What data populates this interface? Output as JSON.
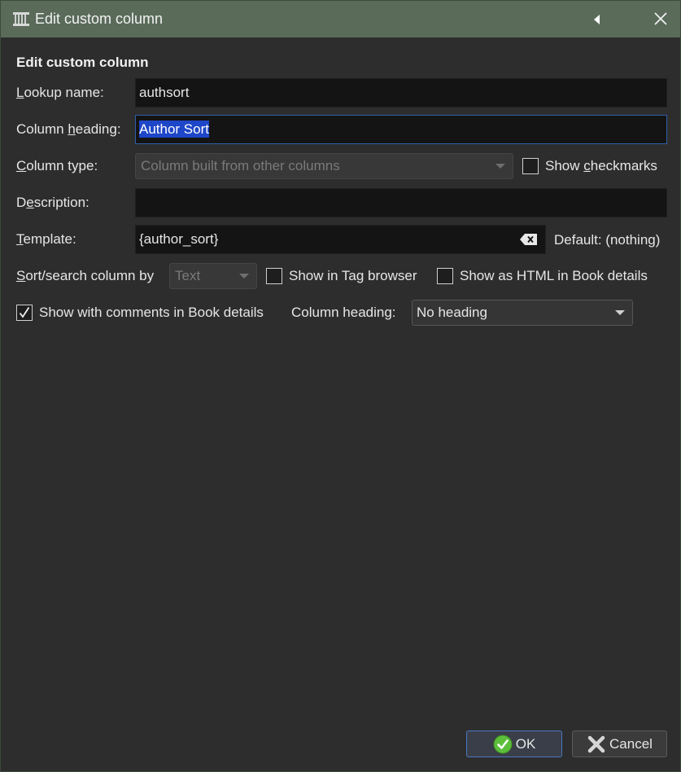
{
  "window": {
    "title": "Edit custom column",
    "colors": {
      "titlebar": "#5a6b5a",
      "background": "#2d2d2d",
      "accent": "#1e46c8"
    }
  },
  "dialog": {
    "heading": "Edit custom column"
  },
  "lookup": {
    "label_u": "L",
    "label_rest": "ookup name:",
    "value": "authsort"
  },
  "column_heading": {
    "label_pre": "Column ",
    "label_u": "h",
    "label_rest": "eading:",
    "value": "Author Sort"
  },
  "column_type": {
    "label_u": "C",
    "label_rest": "olumn type:",
    "value": "Column built from other columns",
    "show_checkmarks_pre": "Show ",
    "show_checkmarks_u": "c",
    "show_checkmarks_rest": "heckmarks",
    "show_checkmarks_checked": false
  },
  "description": {
    "label_pre": "D",
    "label_u": "e",
    "label_rest": "scription:",
    "value": ""
  },
  "template": {
    "label_u": "T",
    "label_rest": "emplate:",
    "value": "{author_sort}",
    "default_text": "Default: (nothing)"
  },
  "sort": {
    "label_u": "S",
    "label_rest": "ort/search column by",
    "value": "Text",
    "show_tag_browser": "Show in Tag browser",
    "show_tag_browser_checked": false,
    "show_html": "Show as HTML in Book details",
    "show_html_checked": false
  },
  "comments": {
    "show_with_comments": "Show with comments in Book details",
    "show_with_comments_checked": true,
    "heading_label": "Column heading:",
    "heading_value": "No heading"
  },
  "buttons": {
    "ok": "OK",
    "cancel": "Cancel"
  }
}
